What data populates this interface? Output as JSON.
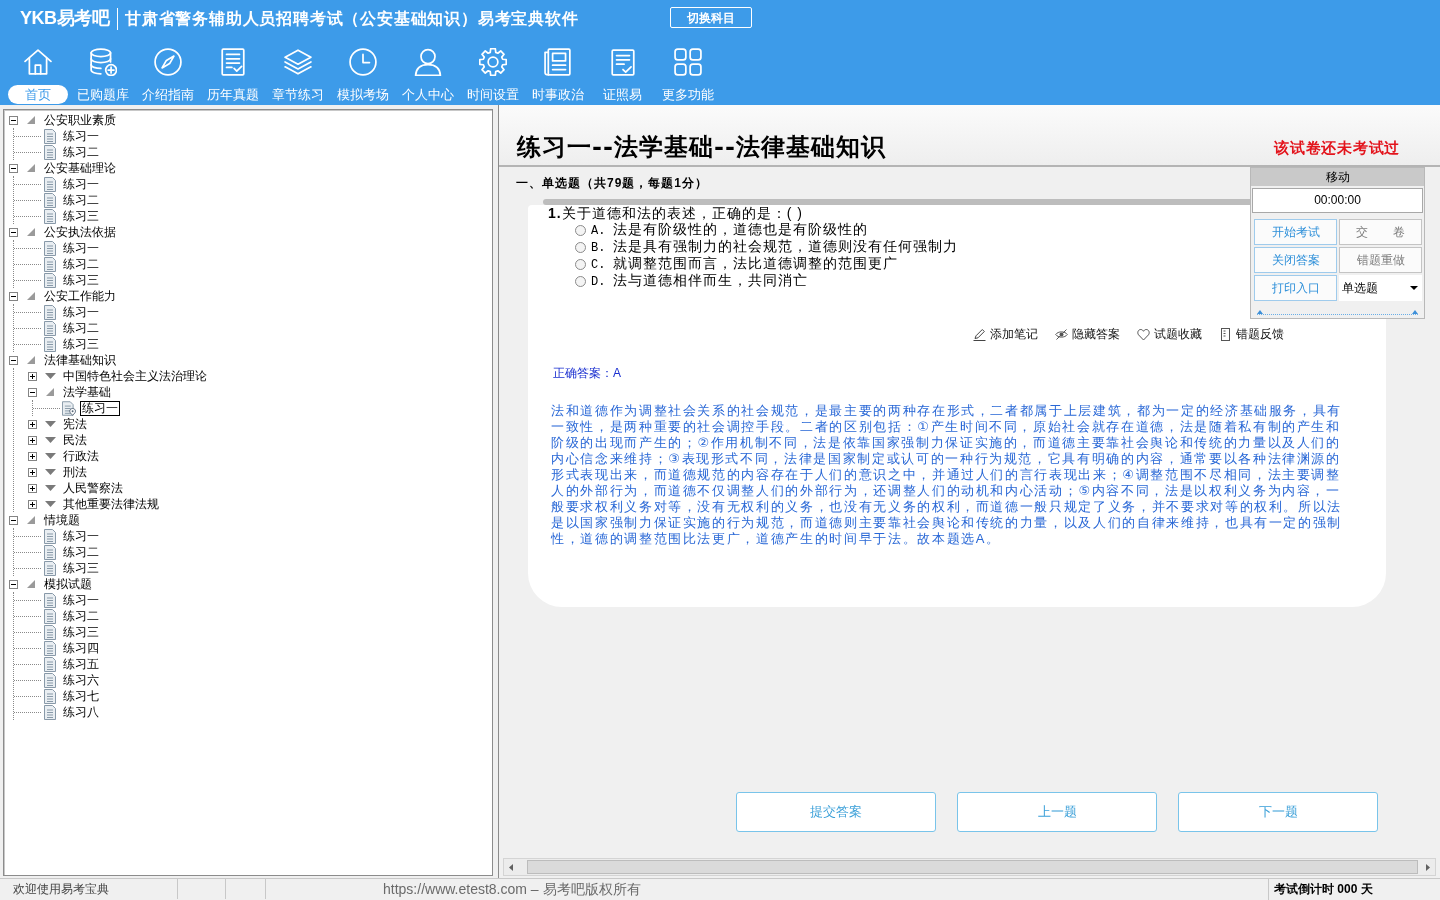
{
  "app": {
    "logo": "YKB易考吧",
    "title": "甘肃省警务辅助人员招聘考试（公安基础知识）易考宝典软件",
    "switch_button": "切换科目"
  },
  "toolbar": [
    {
      "label": "首页",
      "selected": true
    },
    {
      "label": "已购题库",
      "selected": false
    },
    {
      "label": "介绍指南",
      "selected": false
    },
    {
      "label": "历年真题",
      "selected": false
    },
    {
      "label": "章节练习",
      "selected": false
    },
    {
      "label": "模拟考场",
      "selected": false
    },
    {
      "label": "个人中心",
      "selected": false
    },
    {
      "label": "时间设置",
      "selected": false
    },
    {
      "label": "时事政治",
      "selected": false
    },
    {
      "label": "证照易",
      "selected": false
    },
    {
      "label": "更多功能",
      "selected": false
    }
  ],
  "tree": [
    {
      "label": "公安职业素质",
      "kind": "folder",
      "expanded": true,
      "children": [
        {
          "label": "练习一",
          "kind": "exercise",
          "selected": false
        },
        {
          "label": "练习二",
          "kind": "exercise",
          "selected": false
        }
      ]
    },
    {
      "label": "公安基础理论",
      "kind": "folder",
      "expanded": true,
      "children": [
        {
          "label": "练习一",
          "kind": "exercise",
          "selected": false
        },
        {
          "label": "练习二",
          "kind": "exercise",
          "selected": false
        },
        {
          "label": "练习三",
          "kind": "exercise",
          "selected": false
        }
      ]
    },
    {
      "label": "公安执法依据",
      "kind": "folder",
      "expanded": true,
      "children": [
        {
          "label": "练习一",
          "kind": "exercise",
          "selected": false
        },
        {
          "label": "练习二",
          "kind": "exercise",
          "selected": false
        },
        {
          "label": "练习三",
          "kind": "exercise",
          "selected": false
        }
      ]
    },
    {
      "label": "公安工作能力",
      "kind": "folder",
      "expanded": true,
      "children": [
        {
          "label": "练习一",
          "kind": "exercise",
          "selected": false
        },
        {
          "label": "练习二",
          "kind": "exercise",
          "selected": false
        },
        {
          "label": "练习三",
          "kind": "exercise",
          "selected": false
        }
      ]
    },
    {
      "label": "法律基础知识",
      "kind": "folder",
      "expanded": true,
      "children": [
        {
          "label": "中国特色社会主义法治理论",
          "kind": "folder",
          "expanded": false
        },
        {
          "label": "法学基础",
          "kind": "folder",
          "expanded": true,
          "children": [
            {
              "label": "练习一",
              "kind": "exercise",
              "selected": true
            }
          ]
        },
        {
          "label": "宪法",
          "kind": "folder",
          "expanded": false
        },
        {
          "label": "民法",
          "kind": "folder",
          "expanded": false
        },
        {
          "label": "行政法",
          "kind": "folder",
          "expanded": false
        },
        {
          "label": "刑法",
          "kind": "folder",
          "expanded": false
        },
        {
          "label": "人民警察法",
          "kind": "folder",
          "expanded": false
        },
        {
          "label": "其他重要法律法规",
          "kind": "folder",
          "expanded": false
        }
      ]
    },
    {
      "label": "情境题",
      "kind": "folder",
      "expanded": true,
      "children": [
        {
          "label": "练习一",
          "kind": "exercise",
          "selected": false
        },
        {
          "label": "练习二",
          "kind": "exercise",
          "selected": false
        },
        {
          "label": "练习三",
          "kind": "exercise",
          "selected": false
        }
      ]
    },
    {
      "label": "模拟试题",
      "kind": "folder",
      "expanded": true,
      "children": [
        {
          "label": "练习一",
          "kind": "exercise",
          "selected": false
        },
        {
          "label": "练习二",
          "kind": "exercise",
          "selected": false
        },
        {
          "label": "练习三",
          "kind": "exercise",
          "selected": false
        },
        {
          "label": "练习四",
          "kind": "exercise",
          "selected": false
        },
        {
          "label": "练习五",
          "kind": "exercise",
          "selected": false
        },
        {
          "label": "练习六",
          "kind": "exercise",
          "selected": false
        },
        {
          "label": "练习七",
          "kind": "exercise",
          "selected": false
        },
        {
          "label": "练习八",
          "kind": "exercise",
          "selected": false
        }
      ]
    }
  ],
  "exam": {
    "title": "练习一--法学基础--法律基础知识",
    "status": "该试卷还未考试过",
    "section": "一、单选题（共79题，每题1分）",
    "question": {
      "number": "1.",
      "text": "关于道德和法的表述，正确的是：( )",
      "options": [
        {
          "letter": "A.",
          "text": "法是有阶级性的，道德也是有阶级性的",
          "selected": false
        },
        {
          "letter": "B.",
          "text": "法是具有强制力的社会规范，道德则没有任何强制力",
          "selected": false
        },
        {
          "letter": "C.",
          "text": "就调整范围而言，法比道德调整的范围更广",
          "selected": false
        },
        {
          "letter": "D.",
          "text": "法与道德相伴而生，共同消亡",
          "selected": false
        }
      ]
    },
    "actions": [
      {
        "label": "添加笔记"
      },
      {
        "label": "隐藏答案"
      },
      {
        "label": "试题收藏"
      },
      {
        "label": "错题反馈"
      }
    ],
    "answer": "正确答案：A",
    "explanation": "法和道德作为调整社会关系的社会规范，是最主要的两种存在形式，二者都属于上层建筑，都为一定的经济基础服务，具有一致性，是两种重要的社会调控手段。二者的区别包括：①产生时间不同，原始社会就存在道德，法是随着私有制的产生和阶级的出现而产生的；②作用机制不同，法是依靠国家强制力保证实施的，而道德主要靠社会舆论和传统的力量以及人们的内心信念来维持；③表现形式不同，法律是国家制定或认可的一种行为规范，它具有明确的内容，通常要以各种法律渊源的形式表现出来，而道德规范的内容存在于人们的意识之中，并通过人们的言行表现出来；④调整范围不尽相同，法主要调整人的外部行为，而道德不仅调整人们的外部行为，还调整人们的动机和内心活动；⑤内容不同，法是以权利义务为内容，一般要求权利义务对等，没有无权利的义务，也没有无义务的权利，而道德一般只规定了义务，并不要求对等的权利。所以法是以国家强制力保证实施的行为规范，而道德则主要靠社会舆论和传统的力量，以及人们的自律来维持，也具有一定的强制性，道德的调整范围比法更广，道德产生的时间早于法。故本题选A。",
    "nav_buttons": [
      "提交答案",
      "上一题",
      "下一题"
    ]
  },
  "control_panel": {
    "title": "移动",
    "timer": "00:00:00",
    "buttons": [
      {
        "label": "开始考试",
        "disabled": false
      },
      {
        "label": "交 卷",
        "disabled": true
      },
      {
        "label": "关闭答案",
        "disabled": false
      },
      {
        "label": "错题重做",
        "disabled": true
      },
      {
        "label": "打印入口",
        "disabled": false
      }
    ],
    "question_type": "单选题"
  },
  "status_bar": {
    "welcome": "欢迎使用易考宝典",
    "copyright": "https://www.etest8.com – 易考吧版权所有",
    "countdown": "考试倒计时 000 天"
  }
}
